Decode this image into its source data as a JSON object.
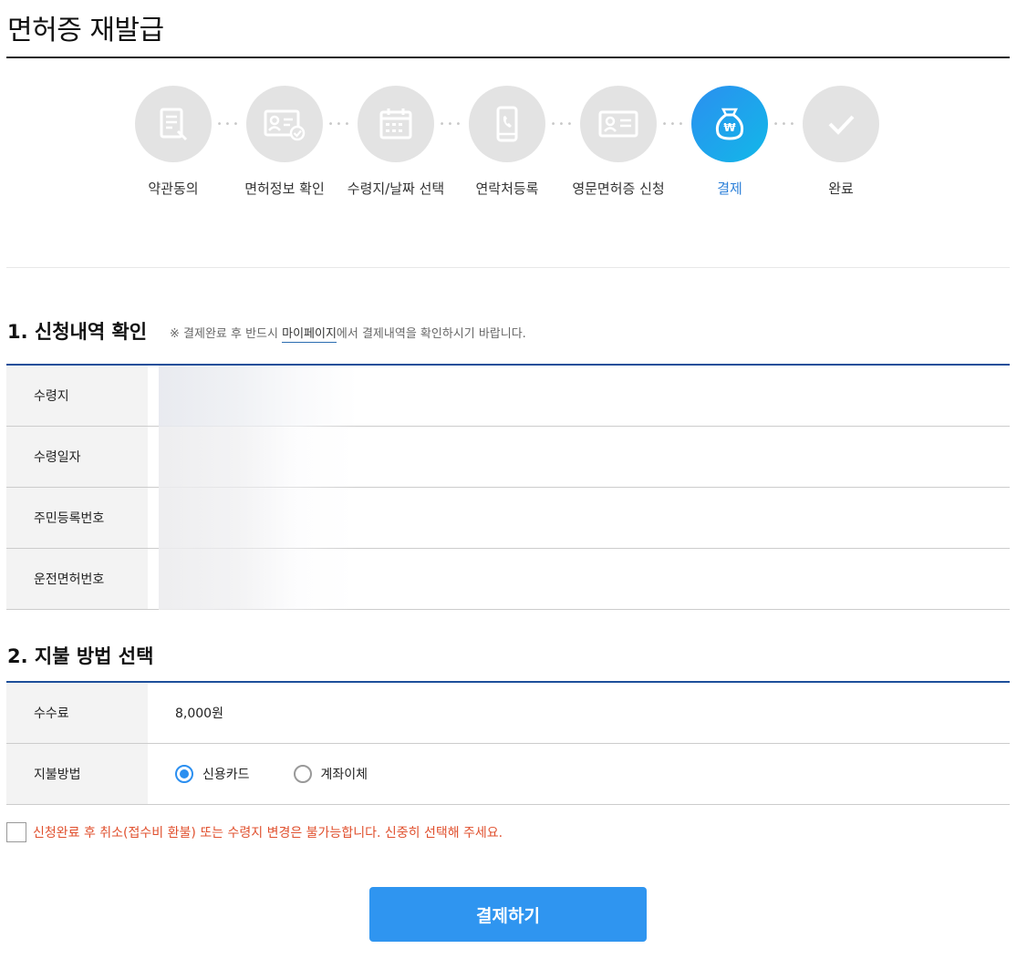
{
  "page": {
    "title": "면허증 재발급"
  },
  "steps": [
    {
      "label": "약관동의",
      "icon": "document-pen-icon",
      "active": false
    },
    {
      "label": "면허정보 확인",
      "icon": "id-card-check-icon",
      "active": false
    },
    {
      "label": "수령지/날짜 선택",
      "icon": "calendar-icon",
      "active": false
    },
    {
      "label": "연락처등록",
      "icon": "phone-icon",
      "active": false
    },
    {
      "label": "영문면허증 신청",
      "icon": "license-card-icon",
      "active": false
    },
    {
      "label": "결제",
      "icon": "money-bag-won-icon",
      "active": true
    },
    {
      "label": "완료",
      "icon": "check-icon",
      "active": false
    }
  ],
  "section1": {
    "title": "1. 신청내역 확인",
    "note_prefix": "※ 결제완료 후 반드시 ",
    "note_link": "마이페이지",
    "note_suffix": "에서 결제내역을 확인하시기 바랍니다.",
    "rows": [
      {
        "label": "수령지"
      },
      {
        "label": "수령일자"
      },
      {
        "label": "주민등록번호"
      },
      {
        "label": "운전면허번호"
      }
    ]
  },
  "section2": {
    "title": "2. 지불 방법 선택",
    "fee_label": "수수료",
    "fee_value": "8,000원",
    "method_label": "지불방법",
    "options": [
      {
        "label": "신용카드",
        "checked": true
      },
      {
        "label": "계좌이체",
        "checked": false
      }
    ]
  },
  "agreement": {
    "text": "신청완료 후 취소(접수비 환불) 또는 수령지 변경은 불가능합니다. 신중히 선택해 주세요.",
    "checked": false
  },
  "pay_button": {
    "label": "결제하기"
  },
  "colors": {
    "accent": "#2f95f0",
    "active_step": "#2b7fd8",
    "warning": "#e0502e",
    "table_rule": "#1d4f9a"
  }
}
